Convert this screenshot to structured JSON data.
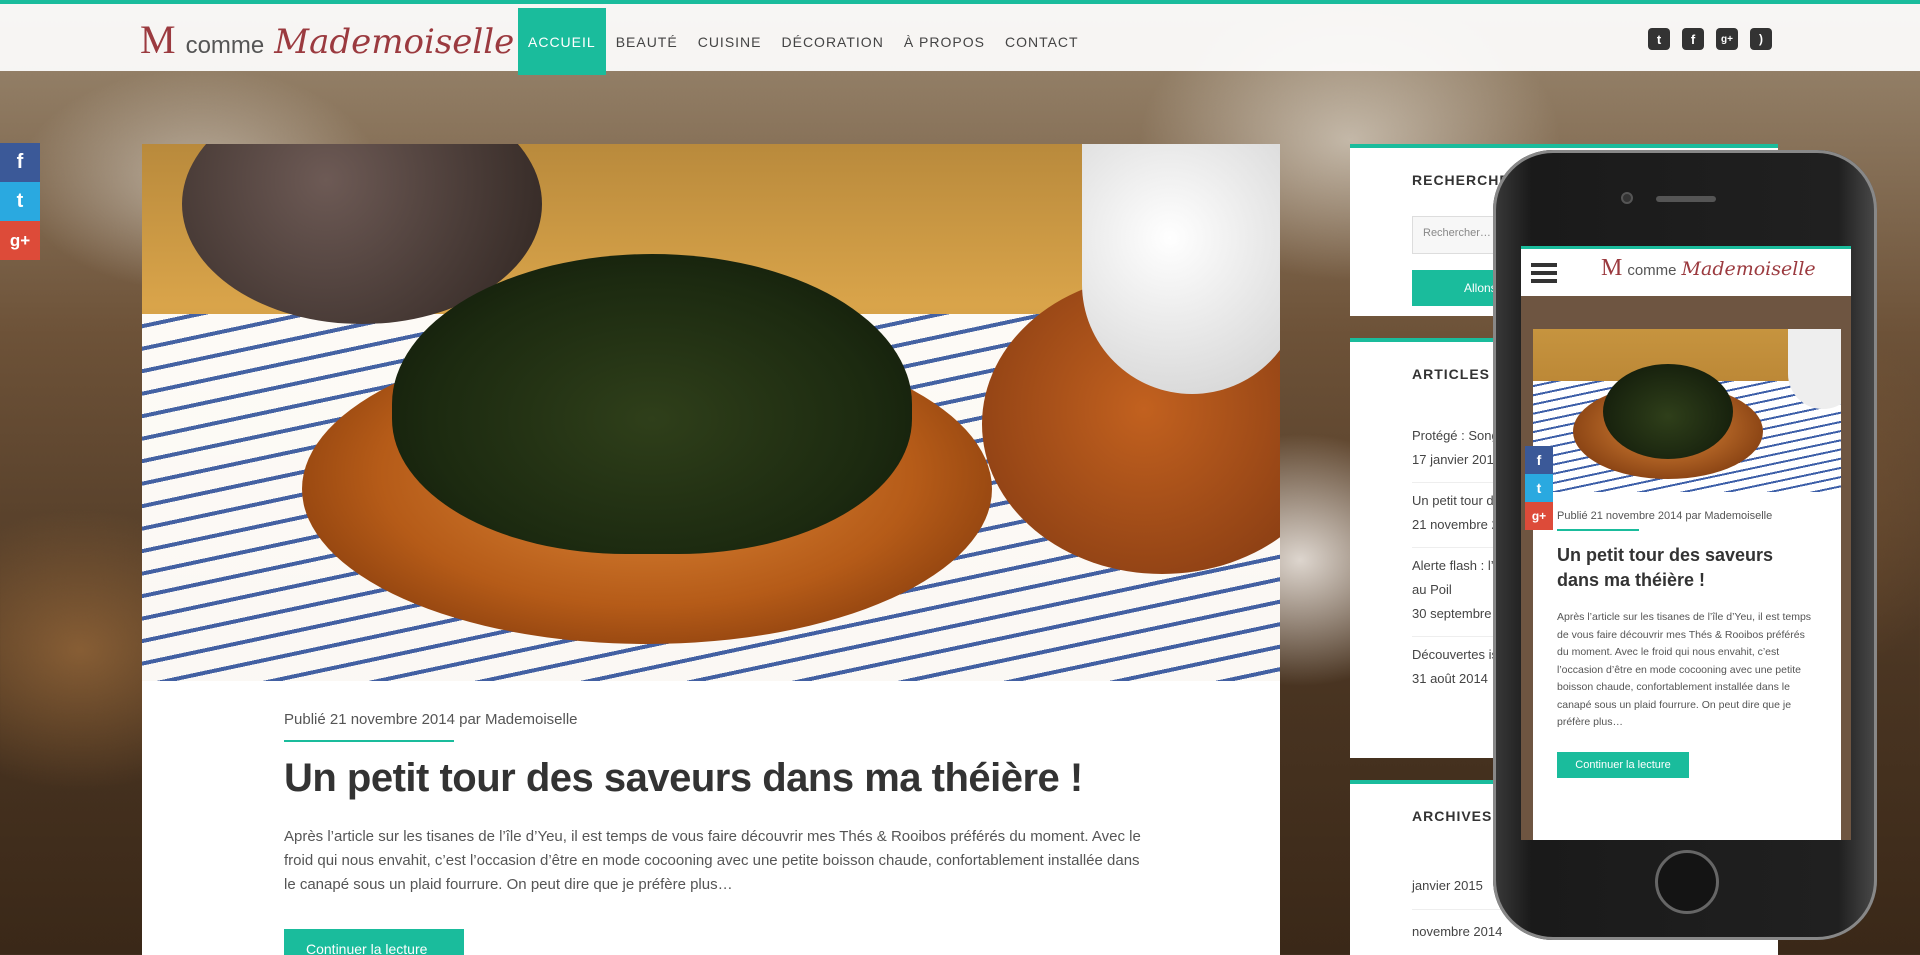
{
  "site": {
    "logo_m": "M",
    "logo_comme": "comme",
    "logo_script": "Mademoiselle"
  },
  "nav": {
    "items": [
      {
        "label": "ACCUEIL"
      },
      {
        "label": "BEAUTÉ"
      },
      {
        "label": "CUISINE"
      },
      {
        "label": "DÉCORATION"
      },
      {
        "label": "À PROPOS"
      },
      {
        "label": "CONTACT"
      }
    ]
  },
  "social_top": {
    "twitter": "t",
    "facebook": "f",
    "googleplus": "g+",
    "rss": "rss"
  },
  "share_left": {
    "facebook": "f",
    "twitter": "t",
    "googleplus": "g+"
  },
  "post": {
    "meta": "Publié 21 novembre 2014 par Mademoiselle",
    "title": "Un petit tour des saveurs dans ma théière !",
    "excerpt": "Après l’article sur les tisanes de l’île d’Yeu, il est temps de vous faire découvrir mes Thés & Rooibos préférés du moment. Avec le froid qui nous envahit, c’est l’occasion d’être en mode cocooning avec une petite boisson chaude, confortablement installée dans le canapé sous un plaid fourrure. On peut dire que je préfère plus…",
    "read_more": "Continuer la lecture"
  },
  "sidebar": {
    "search": {
      "title": "RECHERCHE",
      "placeholder": "Rechercher…",
      "button": "Allons-y"
    },
    "recent": {
      "title": "ARTICLES RÉ",
      "items": [
        {
          "title": "Protégé : Song",
          "date": "17 janvier 201"
        },
        {
          "title": "Un petit tour d",
          "date": "21 novembre 2"
        },
        {
          "title": "Alerte flash : l’é",
          "title2": "au Poil",
          "date": "30 septembre 2"
        },
        {
          "title": "Découvertes is",
          "date": "31 août 2014"
        }
      ]
    },
    "archives": {
      "title": "ARCHIVES",
      "items": [
        "janvier 2015",
        "novembre 2014"
      ]
    }
  },
  "phone": {
    "logo_m": "M",
    "logo_comme": "comme",
    "logo_script": "Mademoiselle",
    "meta": "Publié 21 novembre 2014 par Mademoiselle",
    "title": "Un petit tour des saveurs dans ma théière !",
    "excerpt": "Après l’article sur les tisanes de l’île d’Yeu, il est temps de vous faire découvrir mes Thés & Rooibos préférés du moment. Avec le froid qui nous envahit, c’est l’occasion d’être en mode cocooning avec une petite boisson chaude, confortablement installée dans le canapé sous un plaid fourrure. On peut dire que je préfère plus…",
    "read_more": "Continuer la lecture"
  },
  "colors": {
    "accent": "#1abc9c",
    "brand": "#9b3a3f",
    "facebook": "#3b5998",
    "twitter": "#2aa9e0",
    "googleplus": "#dd4b39"
  }
}
